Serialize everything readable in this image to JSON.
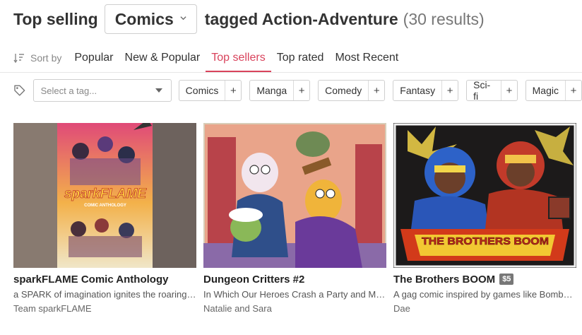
{
  "header": {
    "prefix": "Top selling",
    "category": "Comics",
    "suffix": "tagged Action-Adventure",
    "count": "(30 results)"
  },
  "sort": {
    "label": "Sort by",
    "options": [
      "Popular",
      "New & Popular",
      "Top sellers",
      "Top rated",
      "Most Recent"
    ],
    "active": "Top sellers"
  },
  "tags": {
    "placeholder": "Select a tag...",
    "pills": [
      "Comics",
      "Manga",
      "Comedy",
      "Fantasy",
      "Sci-fi",
      "Magic"
    ],
    "add_symbol": "+"
  },
  "colors": {
    "accent": "#d9435c",
    "price_badge": "#777777"
  },
  "icons": {
    "sort": "sort-descending-icon",
    "tag": "tag-icon",
    "dropdown": "chevron-down-icon"
  },
  "cards": [
    {
      "title": "sparkFLAME Comic Anthology",
      "description": "a SPARK of imagination ignites the roaring FLAME of adventure!",
      "author": "Team sparkFLAME",
      "price": "",
      "cover_text": "sparkFLAME",
      "cover_subtext": "COMIC ANTHOLOGY"
    },
    {
      "title": "Dungeon Critters #2",
      "description": "In Which Our Heroes Crash a Party and Make Some Enemies",
      "author": "Natalie and Sara",
      "price": ""
    },
    {
      "title": "The Brothers BOOM",
      "description": "A gag comic inspired by games like Bomberman and Mega Man",
      "author": "Dae",
      "price": "$5",
      "cover_text": "THE BROTHERS BOOM"
    }
  ]
}
